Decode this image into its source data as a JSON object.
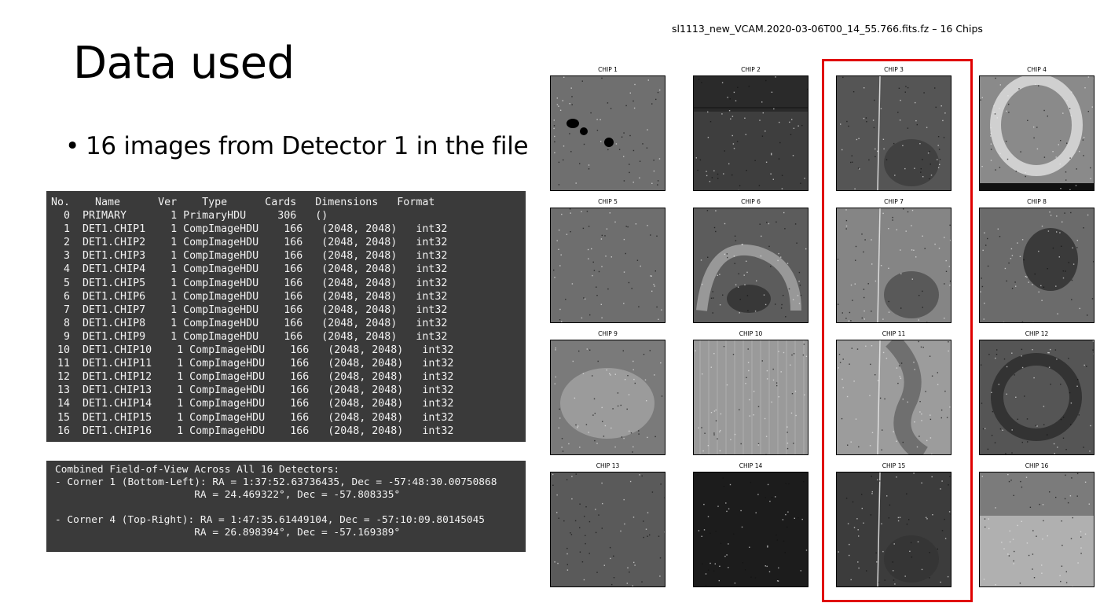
{
  "slide": {
    "title": "Data used",
    "bullet": "16 images from Detector 1 in the file"
  },
  "hdu_table": {
    "cut_top_line": "───────────────────────────────────────────",
    "header": "No.    Name      Ver    Type      Cards   Dimensions   Format",
    "rows": [
      "  0  PRIMARY       1 PrimaryHDU     306   ()",
      "  1  DET1.CHIP1    1 CompImageHDU    166   (2048, 2048)   int32",
      "  2  DET1.CHIP2    1 CompImageHDU    166   (2048, 2048)   int32",
      "  3  DET1.CHIP3    1 CompImageHDU    166   (2048, 2048)   int32",
      "  4  DET1.CHIP4    1 CompImageHDU    166   (2048, 2048)   int32",
      "  5  DET1.CHIP5    1 CompImageHDU    166   (2048, 2048)   int32",
      "  6  DET1.CHIP6    1 CompImageHDU    166   (2048, 2048)   int32",
      "  7  DET1.CHIP7    1 CompImageHDU    166   (2048, 2048)   int32",
      "  8  DET1.CHIP8    1 CompImageHDU    166   (2048, 2048)   int32",
      "  9  DET1.CHIP9    1 CompImageHDU    166   (2048, 2048)   int32",
      " 10  DET1.CHIP10    1 CompImageHDU    166   (2048, 2048)   int32",
      " 11  DET1.CHIP11    1 CompImageHDU    166   (2048, 2048)   int32",
      " 12  DET1.CHIP12    1 CompImageHDU    166   (2048, 2048)   int32",
      " 13  DET1.CHIP13    1 CompImageHDU    166   (2048, 2048)   int32",
      " 14  DET1.CHIP14    1 CompImageHDU    166   (2048, 2048)   int32",
      " 15  DET1.CHIP15    1 CompImageHDU    166   (2048, 2048)   int32",
      " 16  DET1.CHIP16    1 CompImageHDU    166   (2048, 2048)   int32"
    ]
  },
  "fov": {
    "lines": [
      "Combined Field-of-View Across All 16 Detectors:",
      "- Corner 1 (Bottom-Left): RA = 1:37:52.63736435, Dec = -57:48:30.00750868",
      "                       RA = 24.469322°, Dec = -57.808335°",
      "",
      "- Corner 4 (Top-Right): RA = 1:47:35.61449104, Dec = -57:10:09.80145045",
      "                       RA = 26.898394°, Dec = -57.169389°"
    ]
  },
  "figure": {
    "title": "sl1113_new_VCAM.2020-03-06T00_14_55.766.fits.fz – 16 Chips",
    "chips": [
      {
        "label": "CHIP 1",
        "bg": "#6f6f6f",
        "feature": "blobs"
      },
      {
        "label": "CHIP 2",
        "bg": "#3e3e3e",
        "feature": "dark-top"
      },
      {
        "label": "CHIP 3",
        "bg": "#555555",
        "feature": "streak"
      },
      {
        "label": "CHIP 4",
        "bg": "#8a8a8a",
        "feature": "ring"
      },
      {
        "label": "CHIP 5",
        "bg": "#6e6e6e",
        "feature": "plain"
      },
      {
        "label": "CHIP 6",
        "bg": "#5c5c5c",
        "feature": "arc"
      },
      {
        "label": "CHIP 7",
        "bg": "#858585",
        "feature": "streak"
      },
      {
        "label": "CHIP 8",
        "bg": "#6b6b6b",
        "feature": "dark-center"
      },
      {
        "label": "CHIP 9",
        "bg": "#7a7a7a",
        "feature": "oval"
      },
      {
        "label": "CHIP 10",
        "bg": "#9a9a9a",
        "feature": "columns"
      },
      {
        "label": "CHIP 11",
        "bg": "#9c9c9c",
        "feature": "streak-curve"
      },
      {
        "label": "CHIP 12",
        "bg": "#555555",
        "feature": "ring-dark"
      },
      {
        "label": "CHIP 13",
        "bg": "#5a5a5a",
        "feature": "plain"
      },
      {
        "label": "CHIP 14",
        "bg": "#1c1c1c",
        "feature": "dark"
      },
      {
        "label": "CHIP 15",
        "bg": "#3c3c3c",
        "feature": "streak"
      },
      {
        "label": "CHIP 16",
        "bg": "#b0b0b0",
        "feature": "gradient-top"
      }
    ],
    "highlight_color": "#e00000"
  }
}
